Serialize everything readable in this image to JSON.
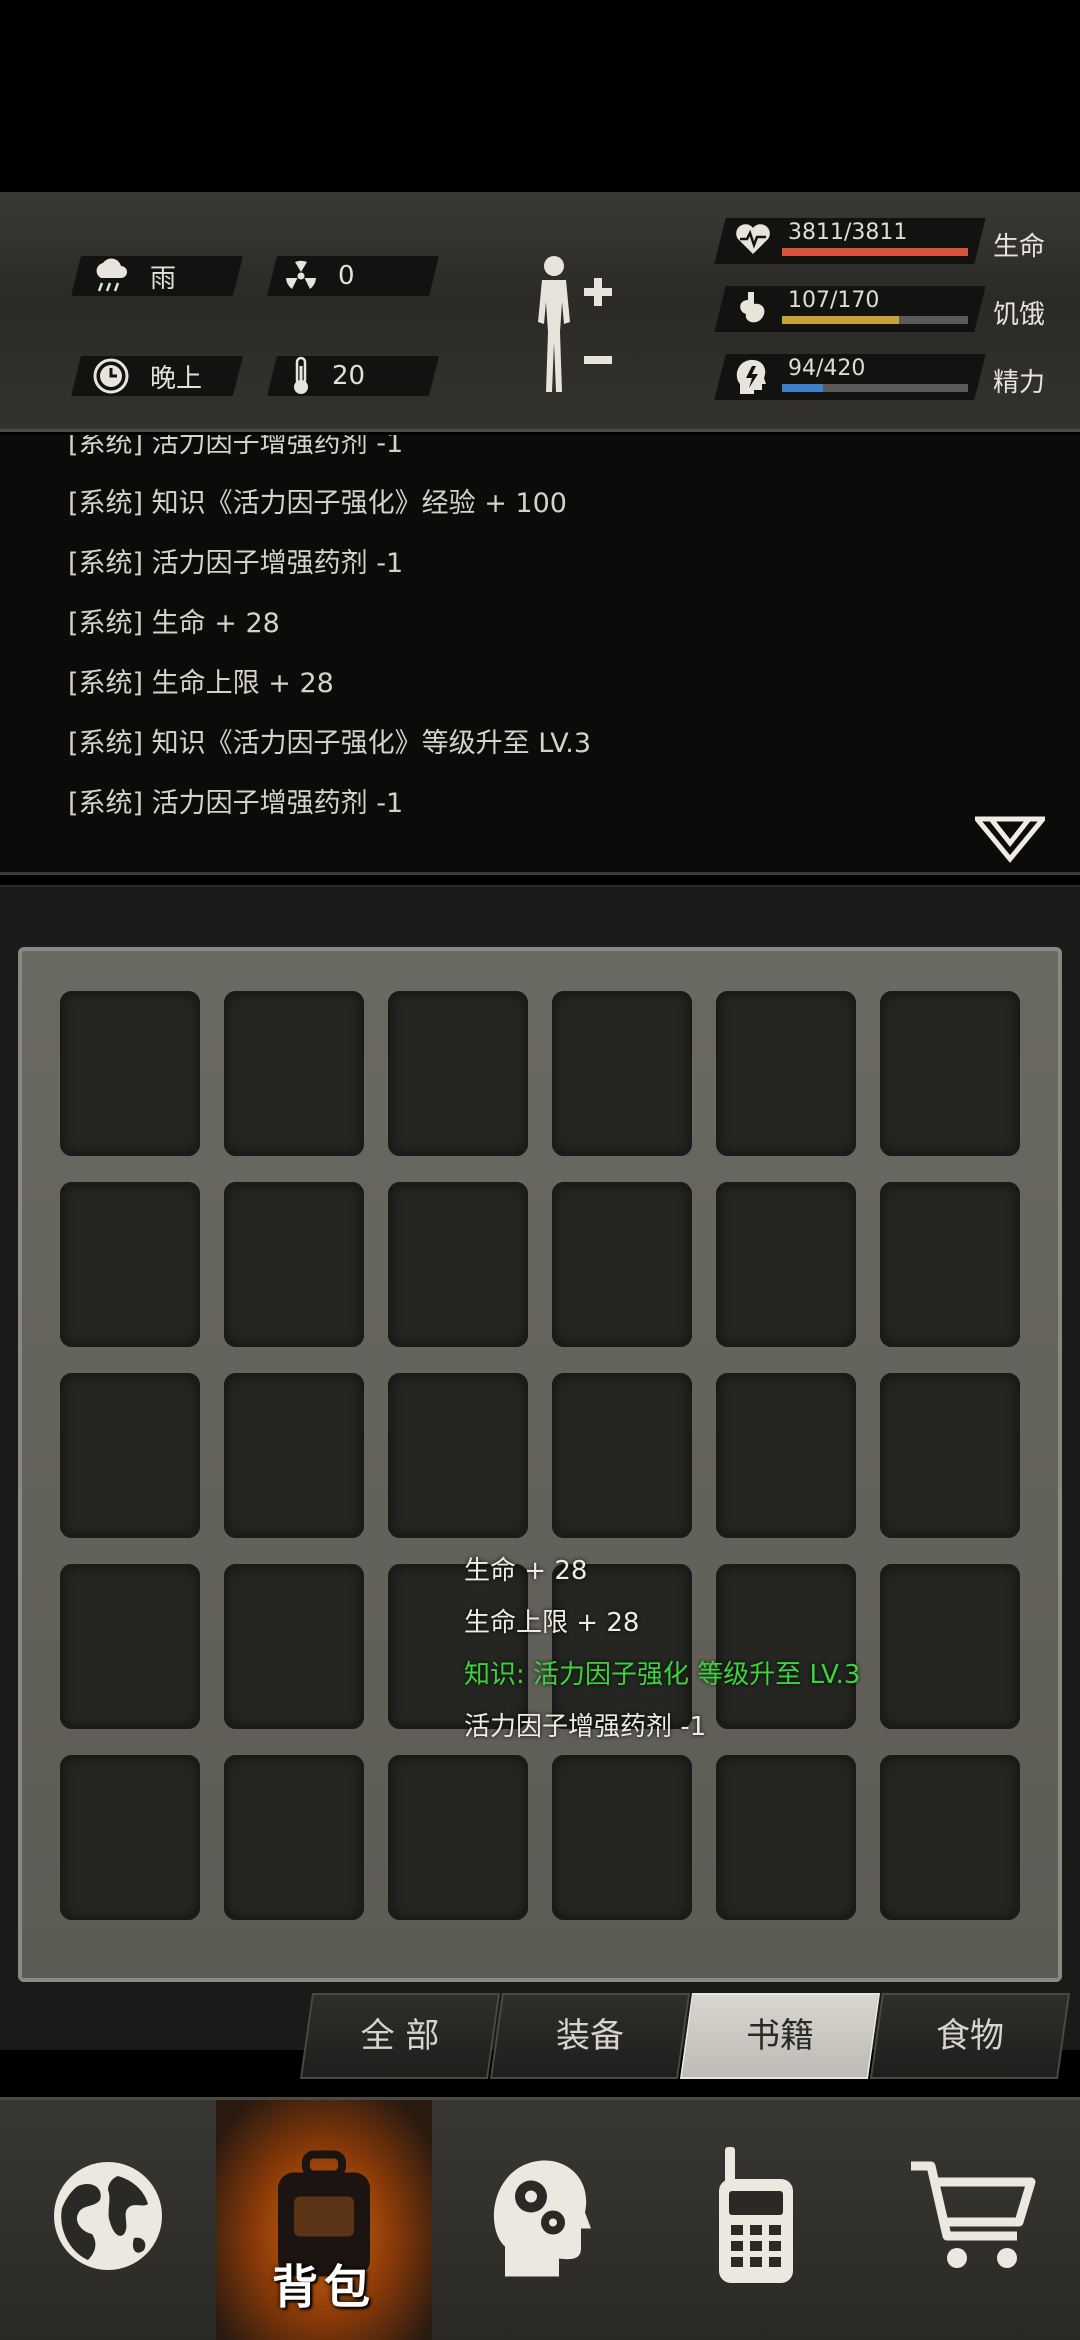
{
  "environment": {
    "weather": {
      "icon": "rain-icon",
      "value": "雨"
    },
    "radiation": {
      "icon": "radiation-icon",
      "value": "0"
    },
    "time": {
      "icon": "clock-icon",
      "value": "晚上"
    },
    "temperature": {
      "icon": "thermometer-icon",
      "value": "20"
    }
  },
  "vitals": [
    {
      "name": "生命",
      "value": "3811/3811",
      "fraction": 1.0,
      "color": "#d9533c",
      "icon": "heart-icon"
    },
    {
      "name": "饥饿",
      "value": "107/170",
      "fraction": 0.63,
      "color": "#c9a13a",
      "icon": "stomach-icon"
    },
    {
      "name": "精力",
      "value": "94/420",
      "fraction": 0.22,
      "color": "#3d7fc9",
      "icon": "head-energy-icon"
    }
  ],
  "log": [
    "[系统] 活力因子增强药剂 -1",
    "[系统] 知识《活力因子强化》经验 + 100",
    "[系统] 活力因子增强药剂 -1",
    "[系统] 生命 + 28",
    "[系统] 生命上限 + 28",
    "[系统] 知识《活力因子强化》等级升至 LV.3",
    "[系统] 活力因子增强药剂 -1"
  ],
  "toast": [
    {
      "text": "生命 + 28",
      "color": "#f0ece4"
    },
    {
      "text": "生命上限 + 28",
      "color": "#f0ece4"
    },
    {
      "text": "知识: 活力因子强化 等级升至 LV.3",
      "color": "#3cd43c"
    },
    {
      "text": "活力因子增强药剂 -1",
      "color": "#f0ece4"
    }
  ],
  "tabs": [
    {
      "label": "全 部",
      "active": false
    },
    {
      "label": "装备",
      "active": false
    },
    {
      "label": "书籍",
      "active": true
    },
    {
      "label": "食物",
      "active": false
    }
  ],
  "nav": [
    {
      "name": "world",
      "icon": "globe-icon",
      "label": ""
    },
    {
      "name": "backpack",
      "icon": "backpack-icon",
      "label": "背包",
      "active": true
    },
    {
      "name": "skills",
      "icon": "head-gears-icon",
      "label": ""
    },
    {
      "name": "radio",
      "icon": "walkie-talkie-icon",
      "label": ""
    },
    {
      "name": "shop",
      "icon": "shopping-cart-icon",
      "label": ""
    }
  ],
  "accent_color": "#d46a12"
}
